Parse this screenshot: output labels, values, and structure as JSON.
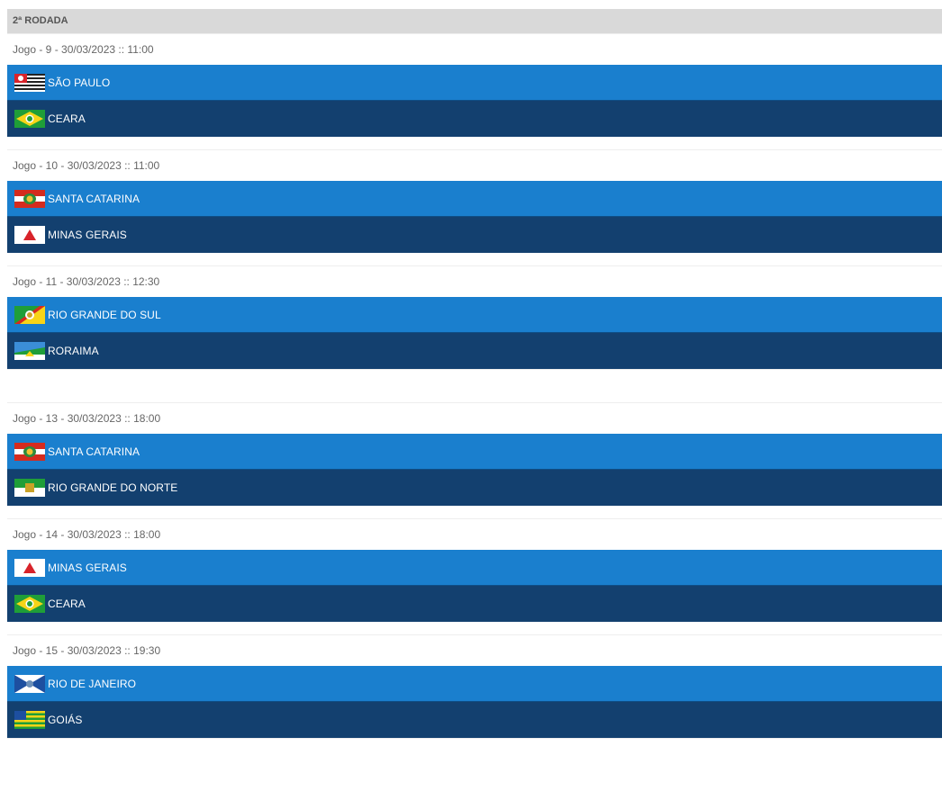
{
  "round": {
    "title": "2ª RODADA"
  },
  "games": [
    {
      "title": "Jogo - 9 - 30/03/2023 :: 11:00",
      "home": {
        "name": "SÃO PAULO",
        "flag": "sao-paulo-flag"
      },
      "away": {
        "name": "CEARA",
        "flag": "ceara-flag"
      }
    },
    {
      "title": "Jogo - 10 - 30/03/2023 :: 11:00",
      "home": {
        "name": "SANTA CATARINA",
        "flag": "santa-catarina-flag"
      },
      "away": {
        "name": "MINAS GERAIS",
        "flag": "minas-gerais-flag"
      }
    },
    {
      "title": "Jogo - 11 - 30/03/2023 :: 12:30",
      "home": {
        "name": "RIO GRANDE DO SUL",
        "flag": "rio-grande-do-sul-flag"
      },
      "away": {
        "name": "RORAIMA",
        "flag": "roraima-flag"
      }
    },
    {
      "title": "Jogo - 13 - 30/03/2023 :: 18:00",
      "home": {
        "name": "SANTA CATARINA",
        "flag": "santa-catarina-flag"
      },
      "away": {
        "name": "RIO GRANDE DO NORTE",
        "flag": "rio-grande-do-norte-flag"
      }
    },
    {
      "title": "Jogo - 14 - 30/03/2023 :: 18:00",
      "home": {
        "name": "MINAS GERAIS",
        "flag": "minas-gerais-flag"
      },
      "away": {
        "name": "CEARA",
        "flag": "ceara-flag"
      }
    },
    {
      "title": "Jogo - 15 - 30/03/2023 :: 19:30",
      "home": {
        "name": "RIO DE JANEIRO",
        "flag": "rio-de-janeiro-flag"
      },
      "away": {
        "name": "GOIÁS",
        "flag": "goias-flag"
      }
    }
  ],
  "colors": {
    "home_row": "#1a7fce",
    "away_row": "#13406f",
    "header_bg": "#d9d9d9"
  }
}
